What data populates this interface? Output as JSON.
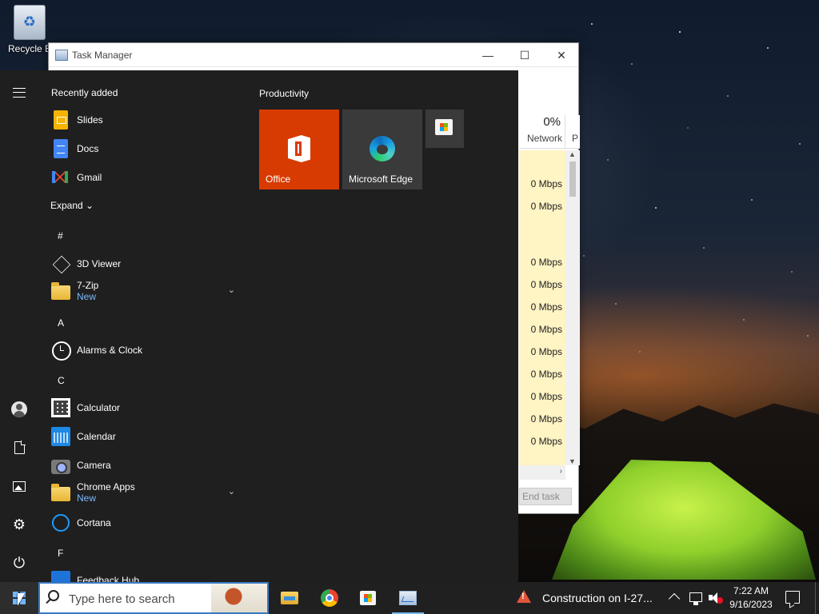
{
  "desktop": {
    "recycle_bin_label": "Recycle B"
  },
  "task_manager": {
    "title": "Task Manager",
    "minimize": "—",
    "maximize": "☐",
    "close": "✕",
    "network_header": {
      "percent": "0%",
      "label": "Network",
      "next_col": "P"
    },
    "rows": [
      "0 Mbps",
      "0 Mbps",
      "",
      "0 Mbps",
      "0 Mbps",
      "0 Mbps",
      "0 Mbps",
      "0 Mbps",
      "0 Mbps",
      "0 Mbps",
      "0 Mbps",
      "0 Mbps"
    ],
    "end_task": "End task"
  },
  "start_menu": {
    "recently_added": "Recently added",
    "recent_apps": [
      {
        "name": "Slides",
        "icon": "slides-icon"
      },
      {
        "name": "Docs",
        "icon": "docs-icon"
      },
      {
        "name": "Gmail",
        "icon": "gmail-icon"
      }
    ],
    "expand": "Expand",
    "groups": [
      {
        "letter": "#",
        "apps": [
          {
            "name": "3D Viewer",
            "sub": ""
          },
          {
            "name": "7-Zip",
            "sub": "New",
            "folder": true
          }
        ]
      },
      {
        "letter": "A",
        "apps": [
          {
            "name": "Alarms & Clock",
            "sub": ""
          }
        ]
      },
      {
        "letter": "C",
        "apps": [
          {
            "name": "Calculator",
            "sub": ""
          },
          {
            "name": "Calendar",
            "sub": ""
          },
          {
            "name": "Camera",
            "sub": ""
          },
          {
            "name": "Chrome Apps",
            "sub": "New",
            "folder": true
          },
          {
            "name": "Cortana",
            "sub": ""
          }
        ]
      },
      {
        "letter": "F",
        "apps": [
          {
            "name": "Feedback Hub",
            "sub": ""
          }
        ]
      }
    ],
    "tiles_group": "Productivity",
    "tiles": [
      {
        "name": "Office",
        "color": "#d83b01"
      },
      {
        "name": "Microsoft Edge",
        "color": "#3a3a3a"
      },
      {
        "name": "",
        "icon": "microsoft-store-icon"
      }
    ]
  },
  "taskbar": {
    "search_placeholder": "Type here to search",
    "pinned": [
      "file-explorer-icon",
      "chrome-icon",
      "microsoft-store-icon",
      "task-manager-icon"
    ],
    "news": "Construction on I-27...",
    "time": "7:22 AM",
    "date": "9/16/2023"
  }
}
